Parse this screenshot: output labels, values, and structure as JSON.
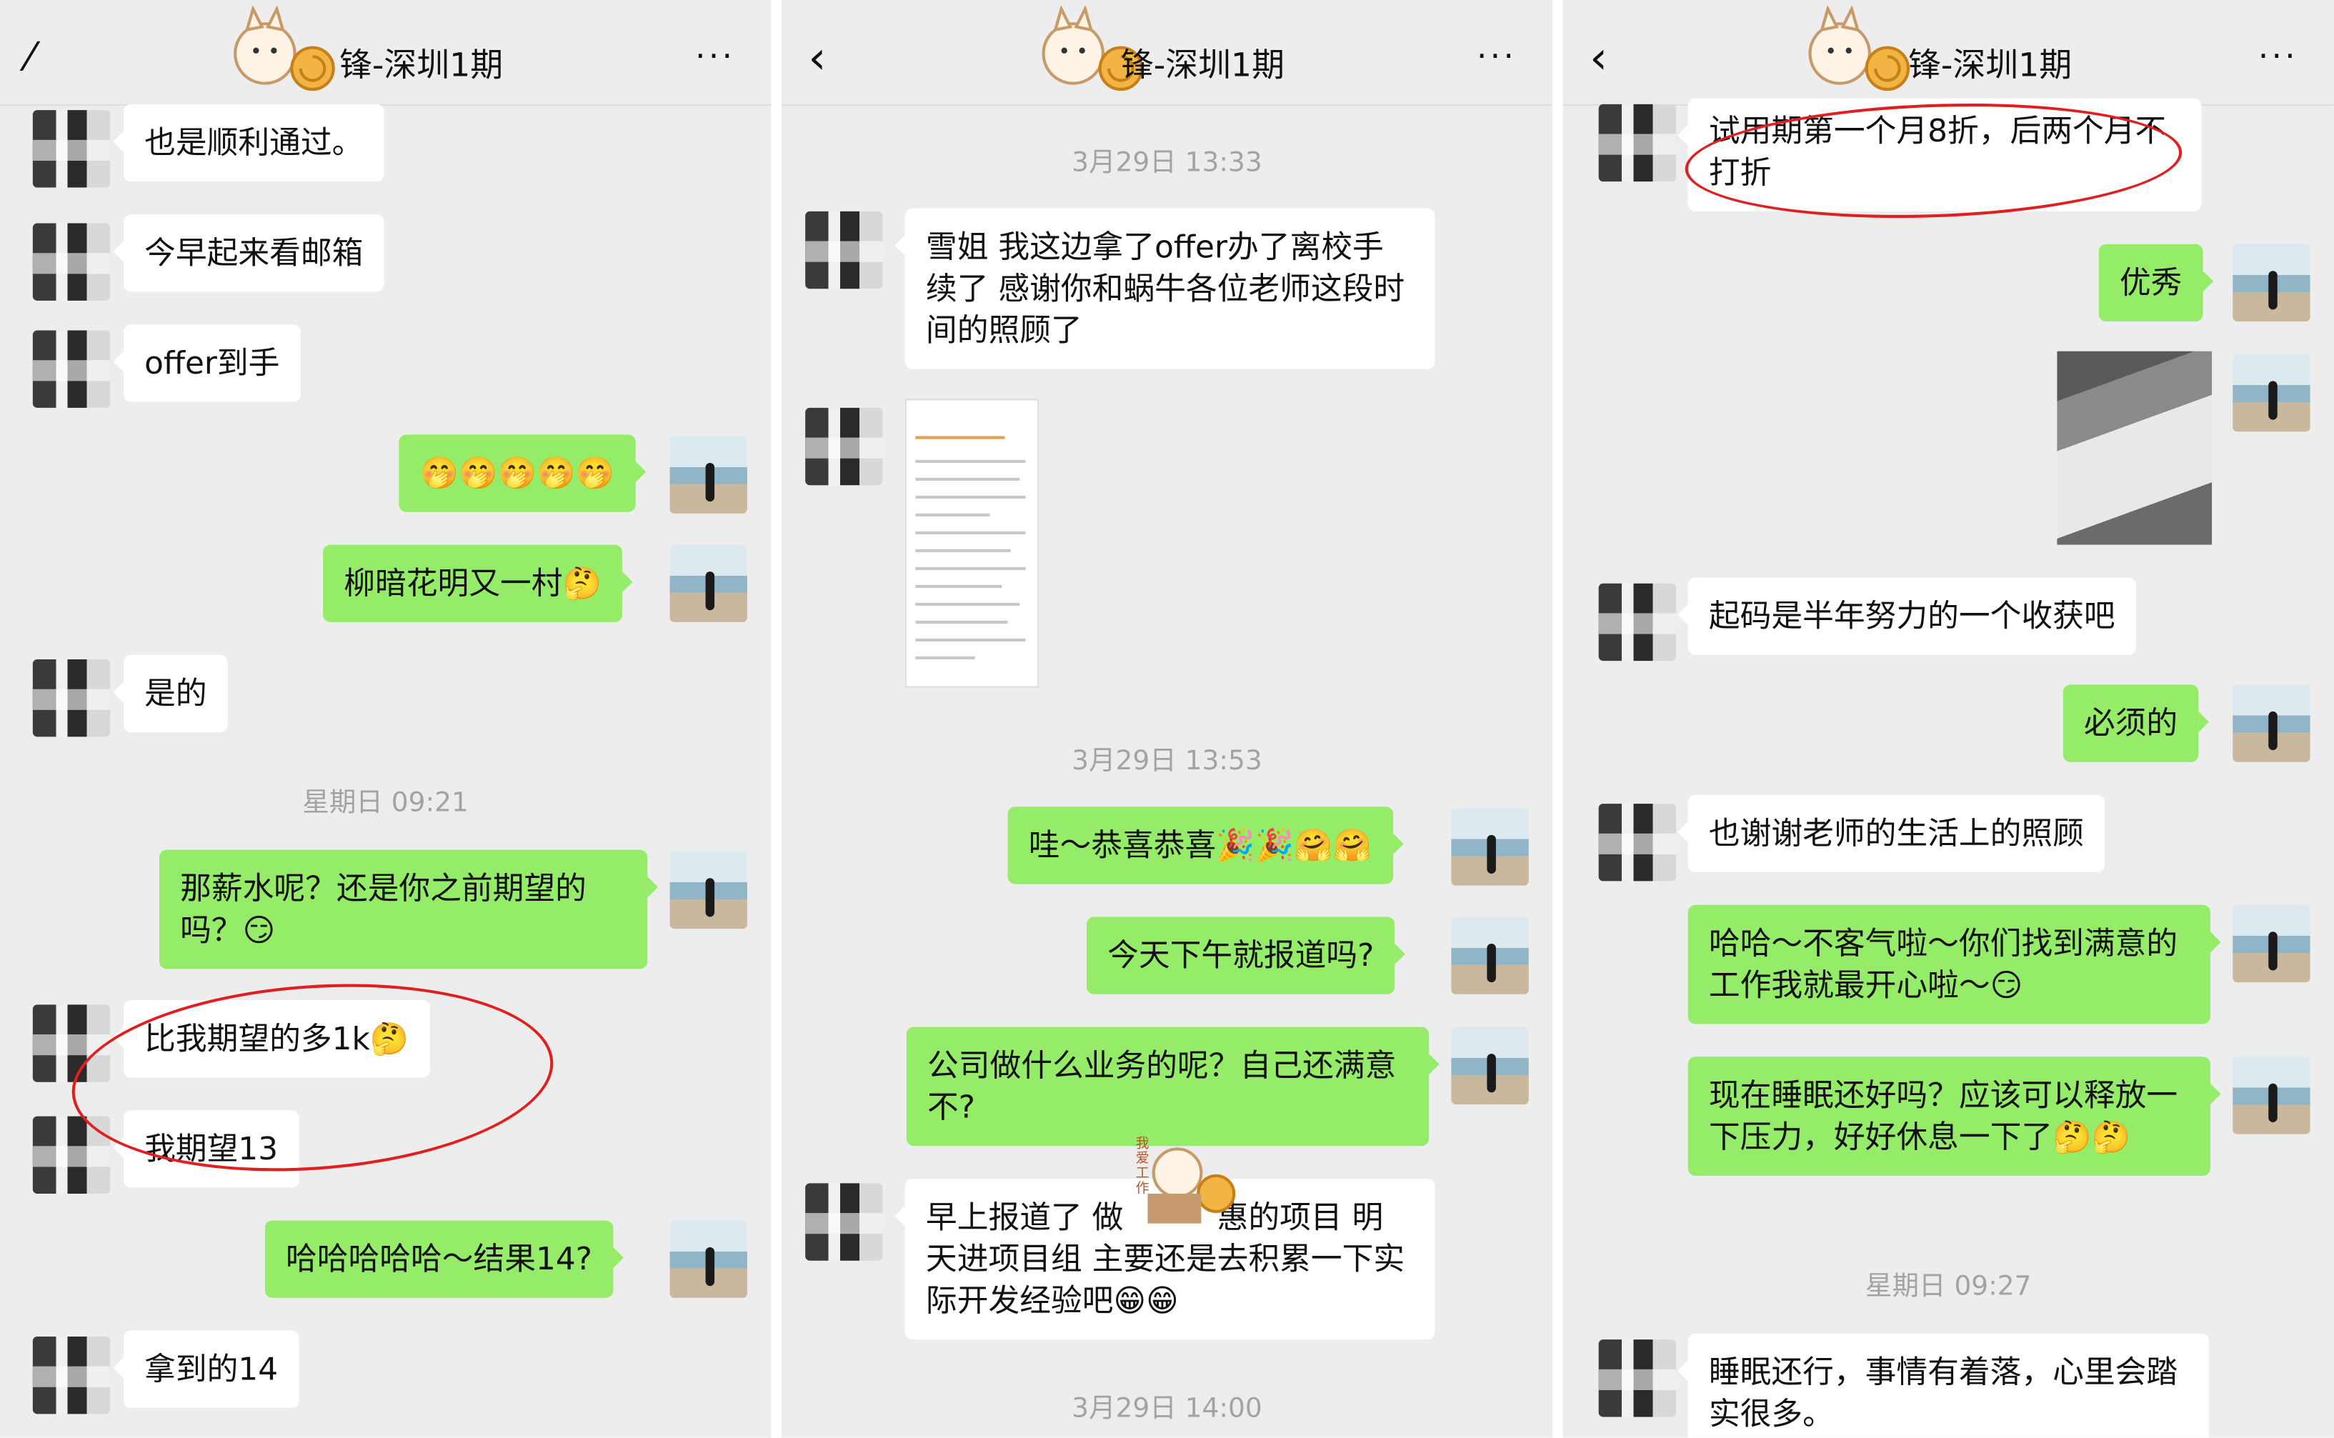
{
  "panels": [
    {
      "title": "蜗牛先锋-深圳1期",
      "title_visible": "锋-深圳1期",
      "back_icon": "‹",
      "more_icon": "···",
      "messages": [
        {
          "side": "left",
          "text": "也是顺利通过。"
        },
        {
          "side": "left",
          "text": "今早起来看邮箱"
        },
        {
          "side": "left",
          "text": "offer到手"
        },
        {
          "side": "right",
          "text": "🤭🤭🤭🤭🤭"
        },
        {
          "side": "right",
          "text": "柳暗花明又一村🤔"
        },
        {
          "side": "left",
          "text": "是的"
        },
        {
          "side": "time",
          "text": "星期日 09:21"
        },
        {
          "side": "right",
          "text": "那薪水呢？还是你之前期望的吗？😏"
        },
        {
          "side": "left",
          "text": "比我期望的多1k🤔"
        },
        {
          "side": "left",
          "text": "我期望13"
        },
        {
          "side": "right",
          "text": "哈哈哈哈哈～结果14?"
        },
        {
          "side": "left",
          "text": "拿到的14"
        }
      ]
    },
    {
      "title": "蜗牛先锋-深圳1期",
      "title_visible": "锋-深圳1期",
      "back_icon": "‹",
      "more_icon": "···",
      "messages": [
        {
          "side": "time",
          "text": "3月29日 13:33"
        },
        {
          "side": "left",
          "text": "雪姐 我这边拿了offer办了离校手续了 感谢你和蜗牛各位老师这段时间的照顾了"
        },
        {
          "side": "image",
          "text": ""
        },
        {
          "side": "time",
          "text": "3月29日 13:53"
        },
        {
          "side": "right",
          "text": "哇～恭喜恭喜🎉🎉🤗🤗"
        },
        {
          "side": "right",
          "text": "今天下午就报道吗?"
        },
        {
          "side": "right",
          "text": "公司做什么业务的呢？自己还满意不?"
        },
        {
          "side": "left",
          "text": "早上报道了 做　　　惠的项目 明天进项目组 主要还是去积累一下实际开发经验吧😁😁"
        },
        {
          "side": "time",
          "text": "3月29日 14:00"
        }
      ]
    },
    {
      "title": "蜗牛先锋-深圳1期",
      "title_visible": "锋-深圳1期",
      "back_icon": "‹",
      "more_icon": "···",
      "messages": [
        {
          "side": "left",
          "text": "试用期第一个月8折，后两个月不打折"
        },
        {
          "side": "right",
          "text": "优秀"
        },
        {
          "side": "image",
          "text": ""
        },
        {
          "side": "left",
          "text": "起码是半年努力的一个收获吧"
        },
        {
          "side": "right",
          "text": "必须的"
        },
        {
          "side": "left",
          "text": "也谢谢老师的生活上的照顾"
        },
        {
          "side": "right",
          "text": "哈哈～不客气啦～你们找到满意的工作我就最开心啦～😏"
        },
        {
          "side": "right",
          "text": "现在睡眠还好吗？应该可以释放一下压力，好好休息一下了🤔🤔"
        },
        {
          "side": "time",
          "text": "星期日 09:27"
        },
        {
          "side": "left",
          "text": "睡眠还行，事情有着落，心里会踏实很多。"
        }
      ]
    }
  ],
  "sticker_text": "我爱工作",
  "colors": {
    "background": "#ededed",
    "bubble_self": "#95ec69",
    "bubble_other": "#ffffff",
    "highlight_ring": "#e02020",
    "timestamp": "#a3a3a3"
  }
}
